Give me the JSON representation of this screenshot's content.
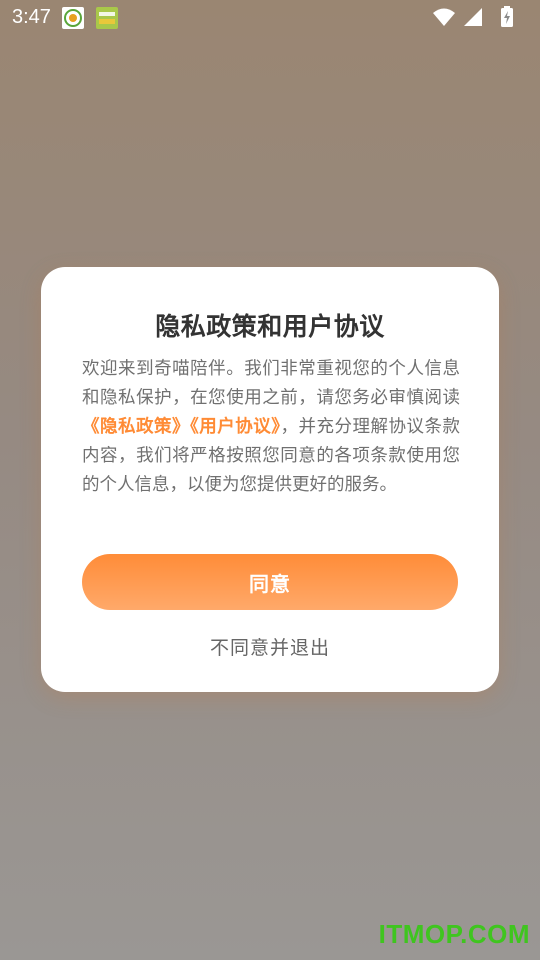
{
  "status_bar": {
    "time": "3:47",
    "notification_icons": [
      "yk-app-icon",
      "green-app-icon"
    ],
    "system_icons": [
      "wifi-icon",
      "signal-icon",
      "battery-icon"
    ]
  },
  "dialog": {
    "title": "隐私政策和用户协议",
    "body": {
      "part1": "欢迎来到奇喵陪伴。我们非常重视您的个人信息和隐私保护，在您使用之前，请您务必审慎阅读",
      "privacy_link": "《隐私政策》",
      "agreement_link": "《用户协议》",
      "part2": "，并充分理解协议条款内容，我们将严格按照您同意的各项条款使用您的个人信息，以便为您提供更好的服务。"
    },
    "agree_label": "同意",
    "disagree_label": "不同意并退出",
    "accent_color": "#ff8b35"
  },
  "watermark": "ITMOP.COM"
}
